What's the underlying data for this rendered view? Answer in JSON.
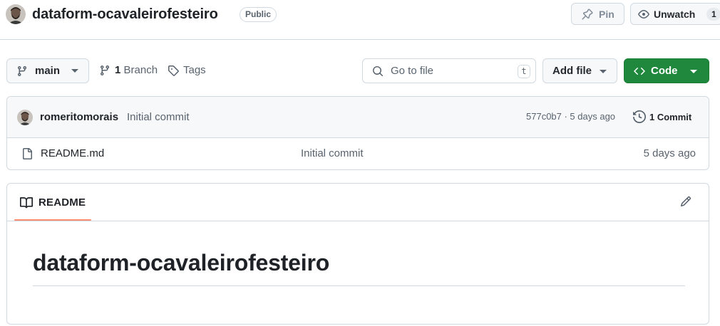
{
  "repo": {
    "name": "dataform-ocavaleirofesteiro",
    "visibility": "Public",
    "pin_label": "Pin",
    "watch_label": "Unwatch",
    "watch_count": "1"
  },
  "file_nav": {
    "branch": "main",
    "branch_count": "1",
    "branch_label": "Branch",
    "tags_label": "Tags",
    "search_placeholder": "Go to file",
    "search_shortcut": "t",
    "add_file_label": "Add file",
    "code_label": "Code"
  },
  "latest_commit": {
    "author": "romeritomorais",
    "message": "Initial commit",
    "meta": "577c0b7 · 5 days ago",
    "commits_count_label": "1 Commit"
  },
  "files": [
    {
      "name": "README.md",
      "commit_message": "Initial commit",
      "age": "5 days ago"
    }
  ],
  "readme": {
    "tab_label": "README",
    "title": "dataform-ocavaleirofesteiro"
  },
  "colors": {
    "accent_green": "#1f883d",
    "tab_underline": "#fd8c73",
    "border": "#d1d9e0",
    "muted_text": "#59636e"
  }
}
